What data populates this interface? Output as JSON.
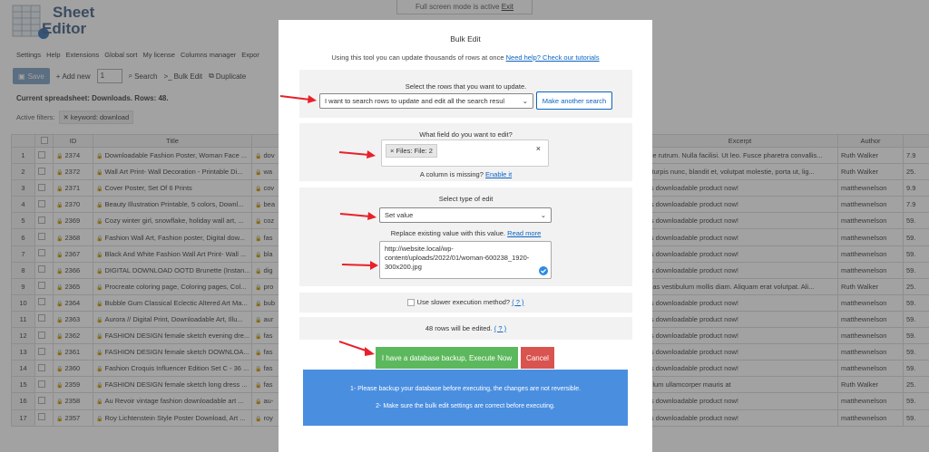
{
  "app": {
    "logo_line1": "Sheet",
    "logo_line2": "Editor",
    "fullscreen_text": "Full screen mode is active",
    "fullscreen_exit": "Exit"
  },
  "menu": [
    "Settings",
    "Help",
    "Extensions",
    "Global sort",
    "My license",
    "Columns manager",
    "Expor"
  ],
  "toolbar": {
    "save": "Save",
    "add_new": "Add new",
    "add_count": "1",
    "search": "Search",
    "bulk_edit": "Bulk Edit",
    "duplicate": "Duplicate"
  },
  "current_sheet": "Current spreadsheet: Downloads. Rows: 48.",
  "filters": {
    "label": "Active filters:",
    "chip": "keyword: download"
  },
  "grid": {
    "headers": [
      "",
      "",
      "ID",
      "Title",
      "",
      "Excerpt",
      "Author",
      ""
    ],
    "rows": [
      {
        "n": "1",
        "id": "2374",
        "title": "Downloadable Fashion Poster, Woman Face ...",
        "f": "dov",
        "excerpt": "que rutrum. Nulla facilisi. Ut leo. Fusce pharetra convallis...",
        "author": "Ruth Walker",
        "p": "7.9"
      },
      {
        "n": "2",
        "id": "2372",
        "title": "Wall Art Print- Wall Decoration - Printable Di...",
        "f": "wa",
        "excerpt": "is turpis nunc, blandit et, volutpat molestie, porta ut, lig...",
        "author": "Ruth Walker",
        "p": "25."
      },
      {
        "n": "3",
        "id": "2371",
        "title": "Cover Poster, Set Of 6 Prints",
        "f": "cov",
        "excerpt": "his downloadable product now!",
        "author": "matthewnelson",
        "p": "9.9"
      },
      {
        "n": "4",
        "id": "2370",
        "title": "Beauty Illustration Printable, 5 colors, Downl...",
        "f": "bea",
        "excerpt": "his downloadable product now!",
        "author": "matthewnelson",
        "p": "7.9"
      },
      {
        "n": "5",
        "id": "2369",
        "title": "Cozy winter girl, snowflake, holiday wall art, ...",
        "f": "coz",
        "excerpt": "his downloadable product now!",
        "author": "matthewnelson",
        "p": "59."
      },
      {
        "n": "6",
        "id": "2368",
        "title": "Fashion Wall Art, Fashion poster, Digital dow...",
        "f": "fas",
        "excerpt": "his downloadable product now!",
        "author": "matthewnelson",
        "p": "59."
      },
      {
        "n": "7",
        "id": "2367",
        "title": "Black And White Fashion Wall Art Print- Wall ...",
        "f": "bla",
        "excerpt": "his downloadable product now!",
        "author": "matthewnelson",
        "p": "59."
      },
      {
        "n": "8",
        "id": "2366",
        "title": "DIGITAL DOWNLOAD OOTD Brunette (Instan...",
        "f": "dig",
        "excerpt": "his downloadable product now!",
        "author": "matthewnelson",
        "p": "59."
      },
      {
        "n": "9",
        "id": "2365",
        "title": "Procreate coloring page, Coloring pages, Col...",
        "f": "pro",
        "excerpt": "enas vestibulum mollis diam. Aliquam erat volutpat. Ali...",
        "author": "Ruth Walker",
        "p": "25."
      },
      {
        "n": "10",
        "id": "2364",
        "title": "Bubble Gum Classical Eclectic Altered Art Ma...",
        "f": "bub",
        "excerpt": "his downloadable product now!",
        "author": "matthewnelson",
        "p": "59."
      },
      {
        "n": "11",
        "id": "2363",
        "title": "Aurora // Digital Print, Downloadable Art, Illu...",
        "f": "aur",
        "excerpt": "his downloadable product now!",
        "author": "matthewnelson",
        "p": "59."
      },
      {
        "n": "12",
        "id": "2362",
        "title": "FASHION DESIGN female sketch evening dre...",
        "f": "fas",
        "excerpt": "his downloadable product now!",
        "author": "matthewnelson",
        "p": "59."
      },
      {
        "n": "13",
        "id": "2361",
        "title": "FASHION DESIGN female sketch DOWNLOA...",
        "f": "fas",
        "excerpt": "his downloadable product now!",
        "author": "matthewnelson",
        "p": "59."
      },
      {
        "n": "14",
        "id": "2360",
        "title": "Fashion Croquis Influencer Edition Set C - 36 ...",
        "f": "fas",
        "excerpt": "his downloadable product now!",
        "author": "matthewnelson",
        "p": "59."
      },
      {
        "n": "15",
        "id": "2359",
        "title": "FASHION DESIGN female sketch long dress ...",
        "f": "fas",
        "excerpt": "pulum ullamcorper mauris at",
        "author": "Ruth Walker",
        "p": "25."
      },
      {
        "n": "16",
        "id": "2358",
        "title": "Au Revoir vintage fashion downloadable art ...",
        "f": "au-",
        "excerpt": "his downloadable product now!",
        "author": "matthewnelson",
        "p": "59."
      },
      {
        "n": "17",
        "id": "2357",
        "title": "Roy Lichtenstein Style Poster Download, Art ...",
        "f": "roy",
        "excerpt": "his downloadable product now!",
        "author": "matthewnelson",
        "p": "59."
      }
    ]
  },
  "modal": {
    "title": "Bulk Edit",
    "desc": "Using this tool you can update thousands of rows at once",
    "help_link": "Need help? Check our tutorials",
    "rows_label": "Select the rows that you want to update.",
    "rows_select": "I want to search rows to update and edit all the search resul",
    "another_search": "Make another search",
    "field_label": "What field do you want to edit?",
    "field_tag": "Files: File: 2",
    "missing_text": "A column is missing?",
    "enable_link": "Enable it",
    "type_label": "Select type of edit",
    "type_select": "Set value",
    "replace_text": "Replace existing value with this value.",
    "read_more": "Read more",
    "value_lines": [
      "http://website.local/wp-",
      "content/uploads/2022/01/woman-600238_1920-",
      "300x200.jpg"
    ],
    "slower_label": "Use slower execution method?",
    "slower_help": "( ? )",
    "rows_edited": "48 rows will be edited.",
    "rows_edited_help": "( ? )",
    "execute": "I have a database backup, Execute Now",
    "cancel": "Cancel",
    "warning1": "1- Please backup your database before executing, the changes are not reversible.",
    "warning2": "2- Make sure the bulk edit settings are correct before executing."
  },
  "colors": {
    "execute": "#5cb85c",
    "cancel": "#d9534f",
    "warning_bg": "#4a8ee0",
    "arrow": "#e8202a",
    "link": "#0b63c4"
  }
}
